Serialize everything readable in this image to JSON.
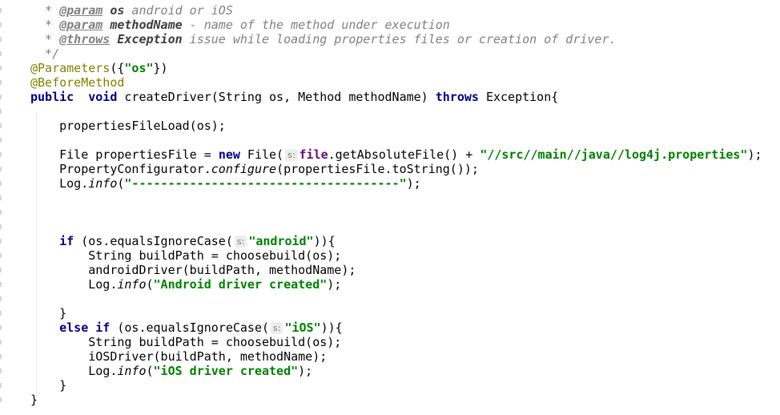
{
  "editor": {
    "lines": [
      [
        {
          "t": "  * ",
          "c": "cm"
        },
        {
          "t": "@param",
          "c": "tag"
        },
        {
          "t": " ",
          "c": "cm"
        },
        {
          "t": "os",
          "c": "pn"
        },
        {
          "t": " android or iOS",
          "c": "cm"
        }
      ],
      [
        {
          "t": "  * ",
          "c": "cm"
        },
        {
          "t": "@param",
          "c": "tag"
        },
        {
          "t": " ",
          "c": "cm"
        },
        {
          "t": "methodName",
          "c": "pn"
        },
        {
          "t": " - name of the method under execution",
          "c": "cm"
        }
      ],
      [
        {
          "t": "  * ",
          "c": "cm"
        },
        {
          "t": "@throws",
          "c": "tag"
        },
        {
          "t": " ",
          "c": "cm"
        },
        {
          "t": "Exception",
          "c": "pn"
        },
        {
          "t": " issue while loading properties files or creation of driver.",
          "c": "cm"
        }
      ],
      [
        {
          "t": "  */",
          "c": "cm"
        }
      ],
      [
        {
          "t": "@Parameters",
          "c": "an"
        },
        {
          "t": "({",
          "c": ""
        },
        {
          "t": "\"os\"",
          "c": "str"
        },
        {
          "t": "})",
          "c": ""
        }
      ],
      [
        {
          "t": "@BeforeMethod",
          "c": "an"
        }
      ],
      [
        {
          "t": "public",
          "c": "kw"
        },
        {
          "t": "  ",
          "c": ""
        },
        {
          "t": "void",
          "c": "kw"
        },
        {
          "t": " createDriver(String os, Method methodName) ",
          "c": ""
        },
        {
          "t": "throws",
          "c": "kw"
        },
        {
          "t": " Exception{",
          "c": ""
        }
      ],
      [],
      [
        {
          "t": "    propertiesFileLoad(os);",
          "c": ""
        }
      ],
      [],
      [
        {
          "t": "    File propertiesFile = ",
          "c": ""
        },
        {
          "t": "new",
          "c": "kw"
        },
        {
          "t": " File(",
          "c": ""
        },
        {
          "t": "s:",
          "c": "hint"
        },
        {
          "t": "file",
          "c": "fld"
        },
        {
          "t": ".getAbsoluteFile() + ",
          "c": ""
        },
        {
          "t": "\"//src//main//java//log4j.properties\"",
          "c": "str"
        },
        {
          "t": ");",
          "c": ""
        }
      ],
      [
        {
          "t": "    PropertyConfigurator.",
          "c": ""
        },
        {
          "t": "configure",
          "c": "it"
        },
        {
          "t": "(propertiesFile.toString());",
          "c": ""
        }
      ],
      [
        {
          "t": "    Log.",
          "c": ""
        },
        {
          "t": "info",
          "c": "it"
        },
        {
          "t": "(",
          "c": ""
        },
        {
          "t": "\"-------------------------------------\"",
          "c": "str"
        },
        {
          "t": ");",
          "c": ""
        }
      ],
      [],
      [],
      [],
      [
        {
          "t": "    ",
          "c": ""
        },
        {
          "t": "if",
          "c": "kw"
        },
        {
          "t": " (os.equalsIgnoreCase(",
          "c": ""
        },
        {
          "t": "s:",
          "c": "hint"
        },
        {
          "t": "\"android\"",
          "c": "str"
        },
        {
          "t": ")){",
          "c": ""
        }
      ],
      [
        {
          "t": "        String buildPath = choosebuild(os);",
          "c": ""
        }
      ],
      [
        {
          "t": "        androidDriver(buildPath, methodName);",
          "c": ""
        }
      ],
      [
        {
          "t": "        Log.",
          "c": ""
        },
        {
          "t": "info",
          "c": "it"
        },
        {
          "t": "(",
          "c": ""
        },
        {
          "t": "\"Android driver created\"",
          "c": "str"
        },
        {
          "t": ");",
          "c": ""
        }
      ],
      [],
      [
        {
          "t": "    }",
          "c": ""
        }
      ],
      [
        {
          "t": "    ",
          "c": ""
        },
        {
          "t": "else if",
          "c": "kw"
        },
        {
          "t": " (os.equalsIgnoreCase(",
          "c": ""
        },
        {
          "t": "s:",
          "c": "hint"
        },
        {
          "t": "\"iOS\"",
          "c": "str"
        },
        {
          "t": ")){",
          "c": ""
        }
      ],
      [
        {
          "t": "        String buildPath = choosebuild(os);",
          "c": ""
        }
      ],
      [
        {
          "t": "        iOSDriver(buildPath, methodName);",
          "c": ""
        }
      ],
      [
        {
          "t": "        Log.",
          "c": ""
        },
        {
          "t": "info",
          "c": "it"
        },
        {
          "t": "(",
          "c": ""
        },
        {
          "t": "\"iOS driver created\"",
          "c": "str"
        },
        {
          "t": ");",
          "c": ""
        }
      ],
      [
        {
          "t": "    }",
          "c": ""
        }
      ],
      [
        {
          "t": "}",
          "c": ""
        }
      ]
    ]
  }
}
